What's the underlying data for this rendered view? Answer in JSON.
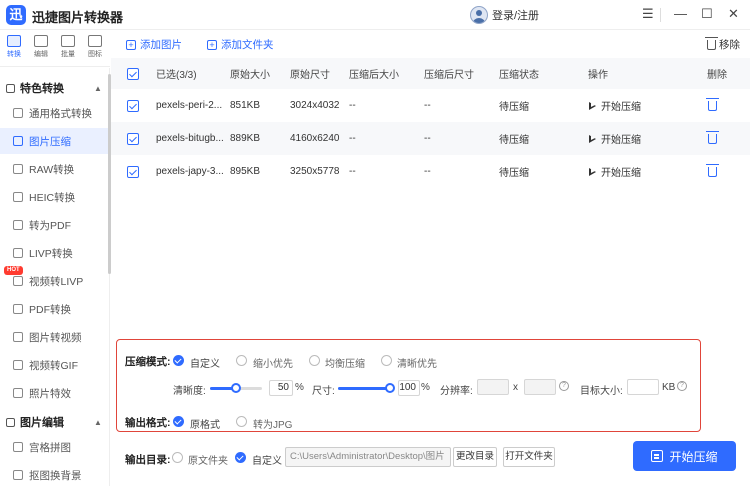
{
  "app": {
    "title": "迅捷图片转换器",
    "logo_char": "迅",
    "login": "登录/注册",
    "accent": "#2f6bff",
    "highlight_border": "#e0453a"
  },
  "window": {
    "menu": "☰",
    "minimize": "—",
    "maximize": "☐",
    "close": "✕"
  },
  "top_nav": [
    "转换",
    "编辑",
    "批量",
    "图标"
  ],
  "sidebar": {
    "section1": "特色转换",
    "items1": [
      "通用格式转换",
      "图片压缩",
      "RAW转换",
      "HEIC转换",
      "转为PDF",
      "LIVP转换",
      "视频转LIVP",
      "PDF转换",
      "图片转视频",
      "视频转GIF",
      "照片特效"
    ],
    "active": "图片压缩",
    "hot_badge": "HOT",
    "section2": "图片编辑",
    "items2": [
      "宫格拼图",
      "抠图换背景"
    ]
  },
  "toolbar": {
    "add_image": "添加图片",
    "add_folder": "添加文件夹",
    "remove": "移除"
  },
  "table": {
    "headers": [
      "已选(3/3)",
      "原始大小",
      "原始尺寸",
      "压缩后大小",
      "压缩后尺寸",
      "压缩状态",
      "操作",
      "删除"
    ],
    "rows": [
      {
        "name": "pexels-peri-2...",
        "size": "851KB",
        "dims": "3024x4032",
        "after_size": "--",
        "after_dims": "--",
        "status": "待压缩",
        "action": "开始压缩"
      },
      {
        "name": "pexels-bitugb...",
        "size": "889KB",
        "dims": "4160x6240",
        "after_size": "--",
        "after_dims": "--",
        "status": "待压缩",
        "action": "开始压缩"
      },
      {
        "name": "pexels-japy-3...",
        "size": "895KB",
        "dims": "3250x5778",
        "after_size": "--",
        "after_dims": "--",
        "status": "待压缩",
        "action": "开始压缩"
      }
    ]
  },
  "settings": {
    "mode_label": "压缩模式:",
    "modes": [
      "自定义",
      "缩小优先",
      "均衡压缩",
      "清晰优先"
    ],
    "selected_mode": "自定义",
    "clarity_label": "清晰度:",
    "clarity_value": "50",
    "pct": "%",
    "size_label": "尺寸:",
    "size_value": "100",
    "resolution_label": "分辨率:",
    "times": "x",
    "help": "?",
    "target_label": "目标大小:",
    "target_unit": "KB",
    "format_label": "输出格式:",
    "formats": [
      "原格式",
      "转为JPG"
    ],
    "clarity_level": 0.5,
    "size_level": 1.0
  },
  "output": {
    "label": "输出目录:",
    "option_original": "原文件夹",
    "option_custom": "自定义",
    "path": "C:\\Users\\Administrator\\Desktop\\图片",
    "change_dir": "更改目录",
    "open_folder": "打开文件夹",
    "start": "开始压缩"
  }
}
